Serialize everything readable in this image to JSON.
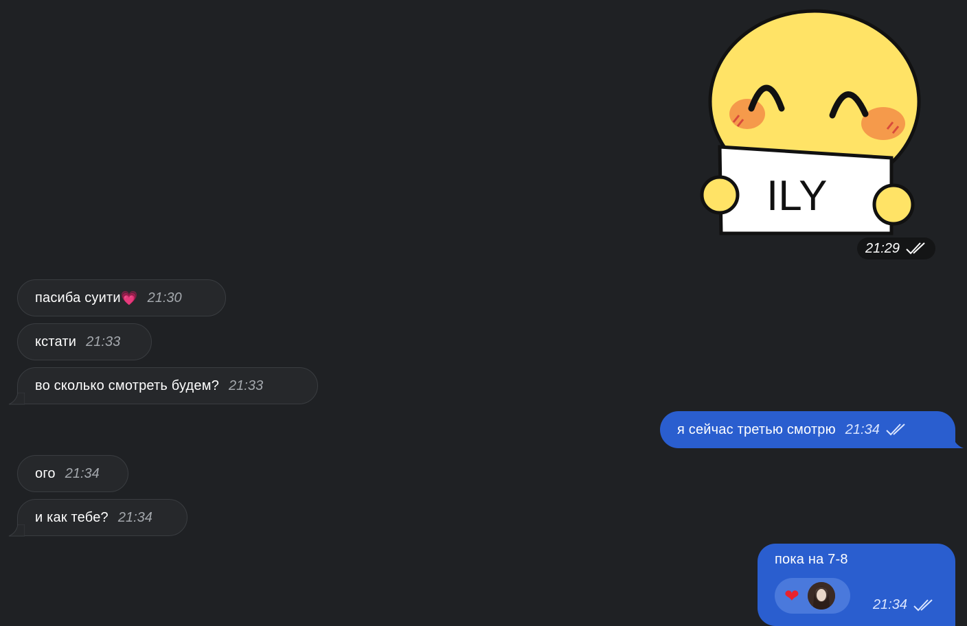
{
  "sticker": {
    "label": "ILY",
    "time": "21:29",
    "status_icon": "double-check-icon"
  },
  "messages_in": [
    {
      "text": "пасиба суити",
      "emoji": "💗",
      "time": "21:30"
    },
    {
      "text": "кстати",
      "time": "21:33"
    },
    {
      "text": "во сколько смотреть будем?",
      "time": "21:33"
    },
    {
      "text": "ого",
      "time": "21:34"
    },
    {
      "text": "и как тебе?",
      "time": "21:34"
    }
  ],
  "messages_out": [
    {
      "text": "я сейчас третью смотрю",
      "time": "21:34",
      "status_icon": "double-check-icon"
    },
    {
      "text": "пока на 7-8",
      "time": "21:34",
      "status_icon": "double-check-icon",
      "reaction": "❤️",
      "reaction_icon": "heart-icon"
    }
  ],
  "colors": {
    "background": "#1f2124",
    "incoming": "#26282b",
    "outgoing": "#2a5ecf"
  }
}
